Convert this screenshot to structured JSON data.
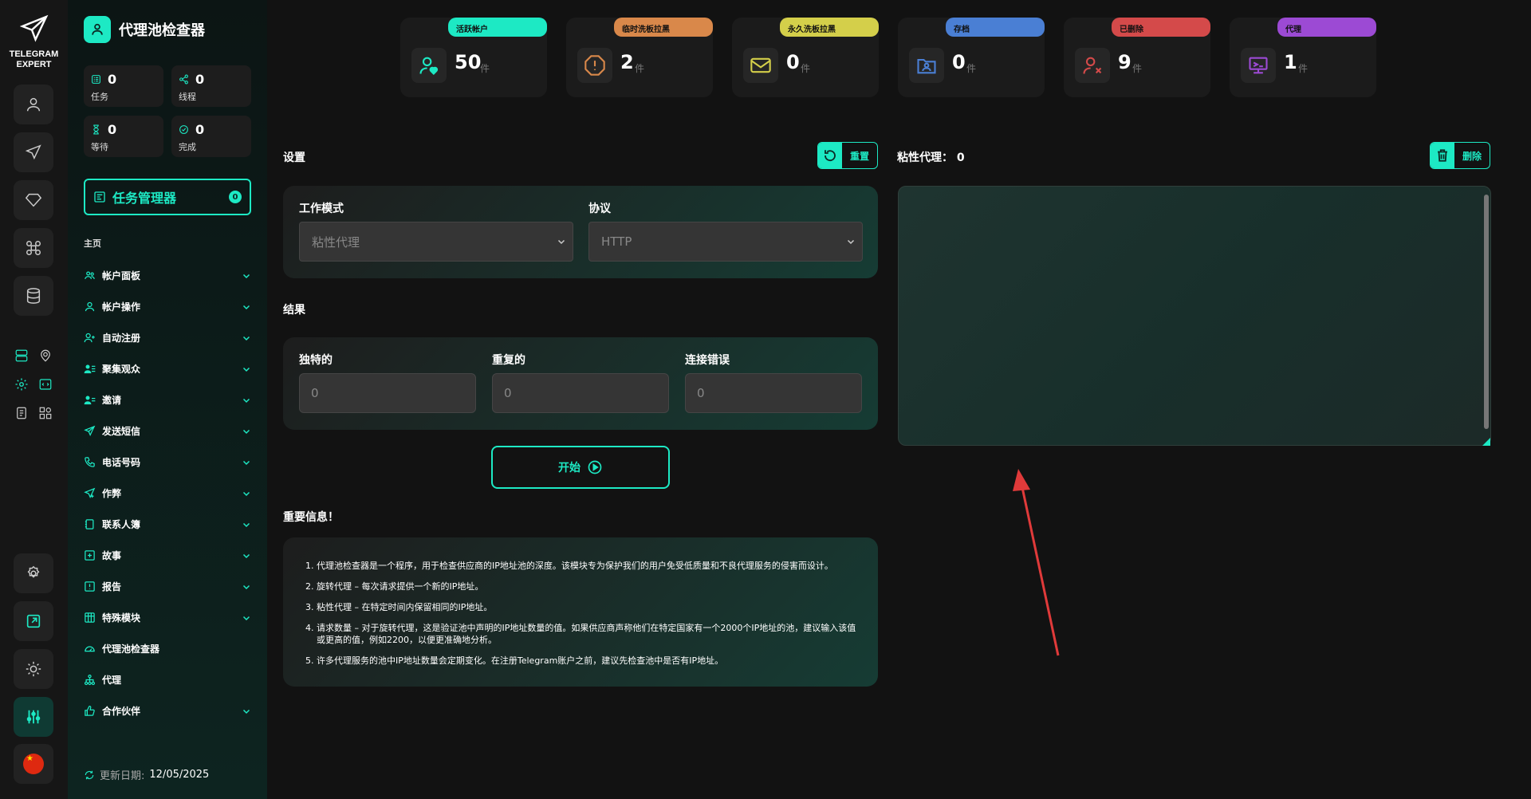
{
  "brand": {
    "line1": "TELEGRAM",
    "line2": "EXPERT"
  },
  "sidebar": {
    "title": "代理池检查器",
    "stats": [
      {
        "value": "0",
        "label": "任务",
        "icon": "tasks-icon"
      },
      {
        "value": "0",
        "label": "线程",
        "icon": "threads-icon"
      },
      {
        "value": "0",
        "label": "等待",
        "icon": "hourglass-icon"
      },
      {
        "value": "0",
        "label": "完成",
        "icon": "check-icon"
      }
    ],
    "task_manager": {
      "label": "任务管理器",
      "count": "0"
    },
    "home_label": "主页",
    "items": [
      {
        "label": "帐户面板",
        "chevron": true
      },
      {
        "label": "帐户操作",
        "chevron": true
      },
      {
        "label": "自动注册",
        "chevron": true
      },
      {
        "label": "聚集观众",
        "chevron": true
      },
      {
        "label": "邀请",
        "chevron": true
      },
      {
        "label": "发送短信",
        "chevron": true
      },
      {
        "label": "电话号码",
        "chevron": true
      },
      {
        "label": "作弊",
        "chevron": true
      },
      {
        "label": "联系人簿",
        "chevron": true
      },
      {
        "label": "故事",
        "chevron": true
      },
      {
        "label": "报告",
        "chevron": true
      },
      {
        "label": "特殊模块",
        "chevron": true
      },
      {
        "label": "代理池检查器",
        "chevron": false
      },
      {
        "label": "代理",
        "chevron": false
      },
      {
        "label": "合作伙伴",
        "chevron": true
      }
    ],
    "update_label": "更新日期:",
    "update_date": "12/05/2025"
  },
  "cards": [
    {
      "tag": "活跃帐户",
      "value": "50",
      "unit": "件",
      "color": "#1de9c4",
      "icon": "user-heart-icon"
    },
    {
      "tag": "临时洗板拉黑",
      "value": "2",
      "unit": "件",
      "color": "#d9884a",
      "icon": "warning-icon"
    },
    {
      "tag": "永久洗板拉黑",
      "value": "0",
      "unit": "件",
      "color": "#d4cf4a",
      "icon": "mail-icon"
    },
    {
      "tag": "存档",
      "value": "0",
      "unit": "件",
      "color": "#4a7fd4",
      "icon": "folder-user-icon"
    },
    {
      "tag": "已删除",
      "value": "9",
      "unit": "件",
      "color": "#d44a4a",
      "icon": "user-x-icon"
    },
    {
      "tag": "代理",
      "value": "1",
      "unit": "件",
      "color": "#9c4ad4",
      "icon": "proxy-icon"
    }
  ],
  "settings": {
    "title": "设置",
    "reset_label": "重置",
    "mode_label": "工作模式",
    "mode_value": "粘性代理",
    "protocol_label": "协议",
    "protocol_value": "HTTP"
  },
  "results": {
    "title": "结果",
    "unique_label": "独特的",
    "unique_value": "0",
    "duplicate_label": "重复的",
    "duplicate_value": "0",
    "error_label": "连接错误",
    "error_value": "0"
  },
  "start_label": "开始",
  "info": {
    "title": "重要信息！",
    "items": [
      "代理池检查器是一个程序，用于检查供应商的IP地址池的深度。该模块专为保护我们的用户免受低质量和不良代理服务的侵害而设计。",
      "旋转代理 – 每次请求提供一个新的IP地址。",
      "粘性代理 – 在特定时间内保留相同的IP地址。",
      "请求数量 – 对于旋转代理，这是验证池中声明的IP地址数量的值。如果供应商声称他们在特定国家有一个2000个IP地址的池，建议输入该值或更高的值，例如2200，以便更准确地分析。",
      "许多代理服务的池中IP地址数量会定期变化。在注册Telegram账户之前，建议先检查池中是否有IP地址。"
    ]
  },
  "sticky": {
    "label": "粘性代理：",
    "count": "0",
    "delete_label": "删除"
  },
  "colors": {
    "accent": "#1de9c4",
    "arrow": "#e03a3a"
  }
}
